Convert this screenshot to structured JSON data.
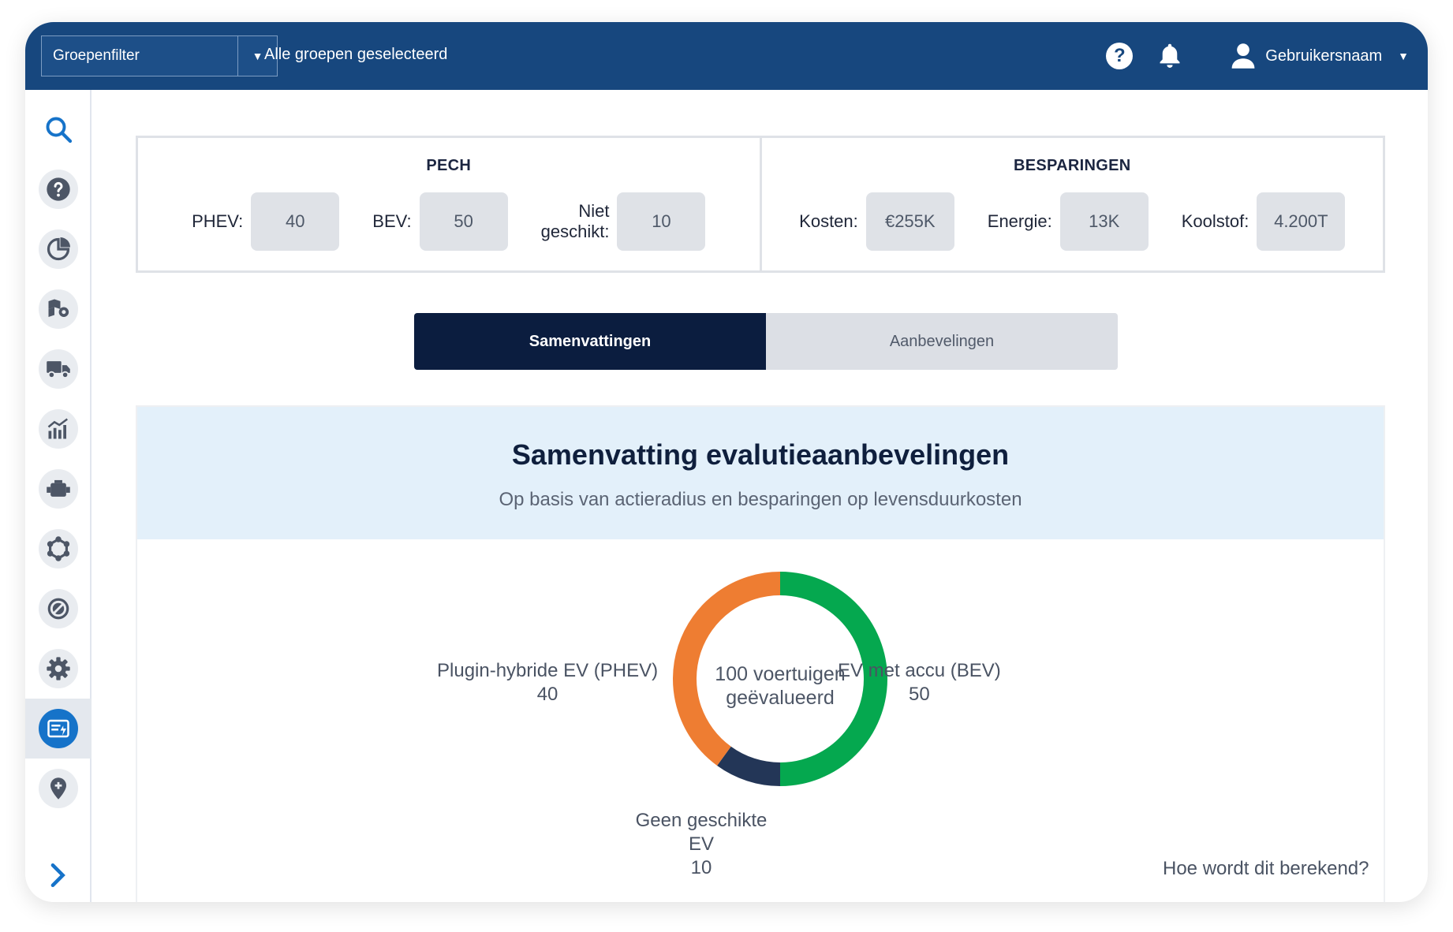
{
  "topbar": {
    "group_filter_label": "Groepenfilter",
    "group_status": "Alle groepen geselecteerd",
    "help_glyph": "?",
    "username": "Gebruikersnaam",
    "icons": [
      "help-icon",
      "bell-icon",
      "user-icon",
      "caret-down-icon"
    ]
  },
  "sidebar": {
    "items": [
      "search-icon",
      "help-icon",
      "pie-chart-icon",
      "map-pin-icon",
      "truck-icon",
      "analytics-icon",
      "engine-icon",
      "hub-icon",
      "block-icon",
      "settings-icon",
      "ev-card-icon",
      "add-location-icon"
    ],
    "active_item": "ev-card-icon",
    "expand_icon": "chevron-right-icon"
  },
  "stats": {
    "pech": {
      "title": "PECH",
      "items": [
        {
          "label": "PHEV:",
          "value": "40"
        },
        {
          "label": "BEV:",
          "value": "50"
        },
        {
          "label_line1": "Niet",
          "label_line2": "geschikt:",
          "value": "10"
        }
      ]
    },
    "besparingen": {
      "title": "BESPARINGEN",
      "items": [
        {
          "label": "Kosten:",
          "value": "€255K"
        },
        {
          "label": "Energie:",
          "value": "13K"
        },
        {
          "label": "Koolstof:",
          "value": "4.200T"
        }
      ]
    }
  },
  "tabs": [
    {
      "label": "Samenvattingen",
      "active": true
    },
    {
      "label": "Aanbevelingen",
      "active": false
    }
  ],
  "summary": {
    "title": "Samenvatting evalutieaanbevelingen",
    "subtitle": "Op basis van actieradius en besparingen op levensduurkosten",
    "center_line1": "100 voertuigen",
    "center_line2": "geëvalueerd",
    "link": "Hoe wordt dit berekend?"
  },
  "chart_data": {
    "type": "pie",
    "categories": [
      "EV met accu (BEV)",
      "Geen geschikte EV",
      "Plugin-hybride EV (PHEV)"
    ],
    "values": [
      50,
      10,
      40
    ],
    "labels": [
      "50",
      "10",
      "40"
    ],
    "colors": [
      "#05a84f",
      "#233657",
      "#ee7d32"
    ]
  },
  "colors": {
    "topbar": "#17477e",
    "active_tab": "#0b1d3f",
    "accent": "#1673c9",
    "panel_head": "#e3f0fa"
  }
}
